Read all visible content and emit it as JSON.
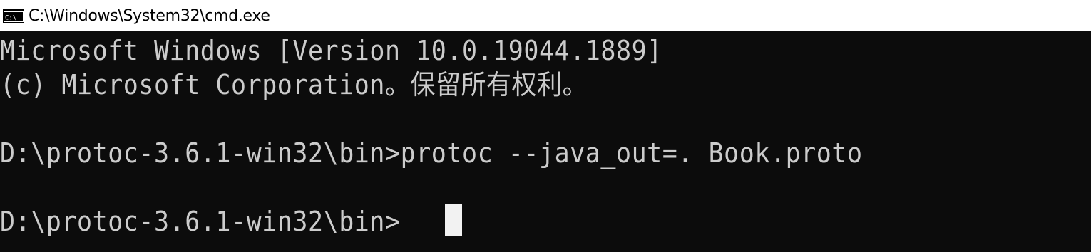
{
  "window": {
    "title": "C:\\Windows\\System32\\cmd.exe",
    "icon": "cmd-icon"
  },
  "console": {
    "lines": [
      "Microsoft Windows [Version 10.0.19044.1889]",
      "(c) Microsoft Corporation。保留所有权利。",
      "D:\\protoc-3.6.1-win32\\bin>protoc --java_out=. Book.proto",
      "D:\\protoc-3.6.1-win32\\bin>"
    ]
  },
  "colors": {
    "background": "#0c0c0c",
    "text": "#cccccc",
    "titlebar": "#ffffff",
    "cursor": "#f2f2f2"
  }
}
